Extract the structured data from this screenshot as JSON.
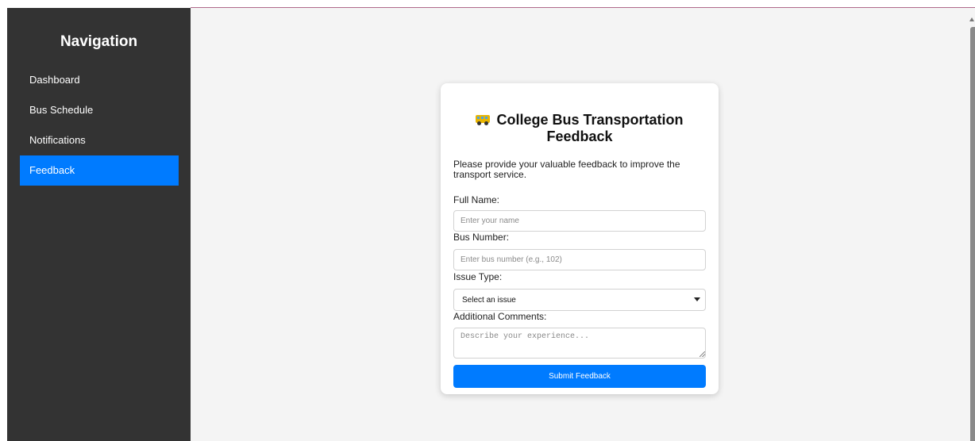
{
  "sidebar": {
    "title": "Navigation",
    "items": [
      {
        "label": "Dashboard",
        "active": false
      },
      {
        "label": "Bus Schedule",
        "active": false
      },
      {
        "label": "Notifications",
        "active": false
      },
      {
        "label": "Feedback",
        "active": true
      }
    ]
  },
  "form": {
    "icon": "bus-icon",
    "title": "College Bus Transportation Feedback",
    "description": "Please provide your valuable feedback to improve the transport service.",
    "full_name": {
      "label": "Full Name:",
      "placeholder": "Enter your name",
      "value": ""
    },
    "bus_number": {
      "label": "Bus Number:",
      "placeholder": "Enter bus number (e.g., 102)",
      "value": ""
    },
    "issue_type": {
      "label": "Issue Type:",
      "selected": "Select an issue"
    },
    "comments": {
      "label": "Additional Comments:",
      "placeholder": "Describe your experience...",
      "value": ""
    },
    "submit_label": "Submit Feedback"
  },
  "colors": {
    "sidebar_bg": "#333333",
    "accent": "#007bff",
    "page_bg": "#f4f4f4"
  }
}
